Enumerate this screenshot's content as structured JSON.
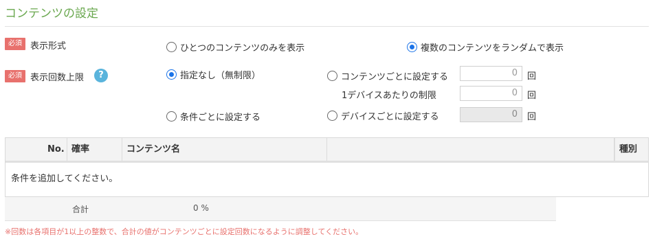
{
  "section": {
    "title": "コンテンツの設定"
  },
  "display_format": {
    "required_badge": "必須",
    "label": "表示形式",
    "options": [
      {
        "label": "ひとつのコンテンツのみを表示",
        "selected": false
      },
      {
        "label": "複数のコンテンツをランダムで表示",
        "selected": true
      }
    ]
  },
  "display_limit": {
    "required_badge": "必須",
    "label": "表示回数上限",
    "help_glyph": "?",
    "options": {
      "none": {
        "label": "指定なし（無制限）",
        "selected": true
      },
      "per_content": {
        "label": "コンテンツごとに設定する",
        "selected": false
      },
      "per_condition": {
        "label": "条件ごとに設定する",
        "selected": false
      },
      "per_device": {
        "label": "デバイスごとに設定する",
        "selected": false
      }
    },
    "per_content_value": "0",
    "per_device_limit_label": "1デバイスあたりの制限",
    "per_device_limit_value": "0",
    "per_device_value": "0",
    "unit": "回"
  },
  "table": {
    "columns": [
      "No.",
      "確率",
      "コンテンツ名",
      "種別"
    ],
    "empty_message": "条件を追加してください。",
    "total_label": "合計",
    "total_value": "0 %"
  },
  "note": "※回数は各項目が1以上の整数で、合計の値がコンテンツごとに設定回数になるように調整してください。",
  "colors": {
    "accent_green": "#6aa84f",
    "badge_red": "#e8716d",
    "radio_blue": "#1a73e8",
    "help_blue": "#5ab4dc"
  }
}
